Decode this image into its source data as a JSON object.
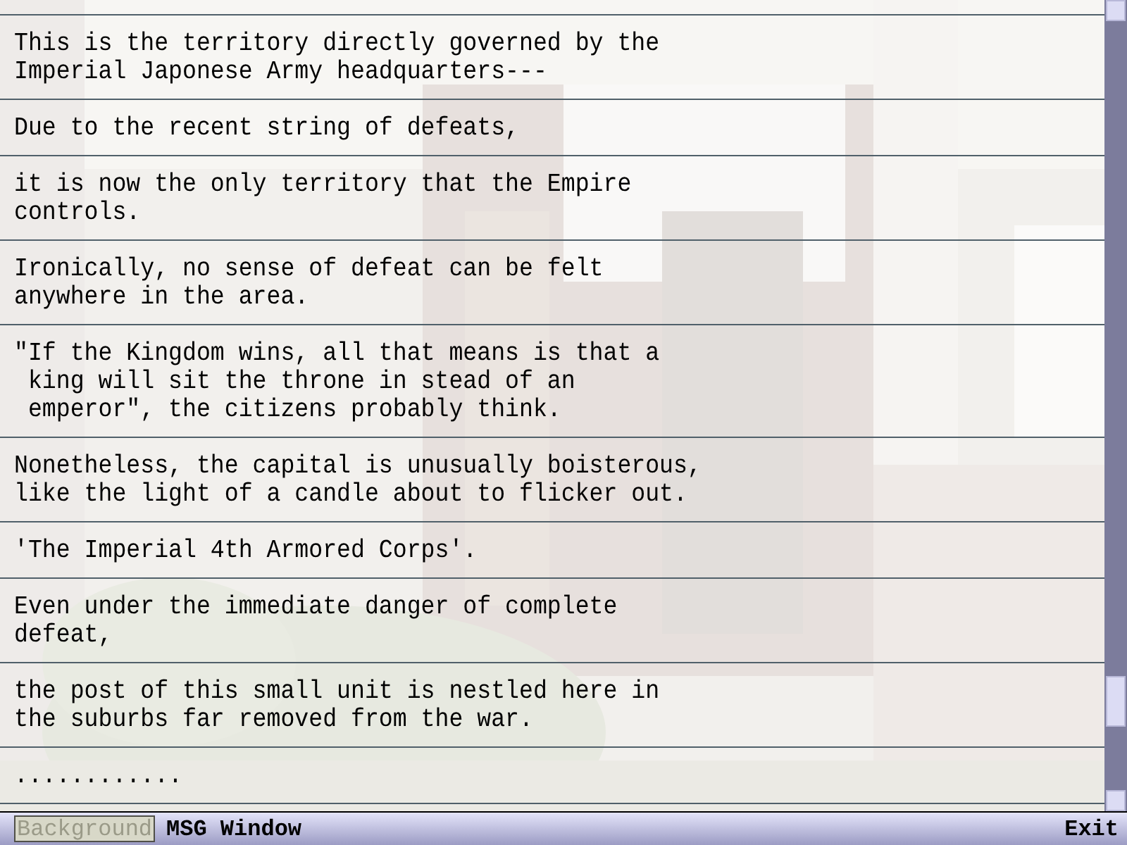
{
  "log": [
    {
      "lines": [
        "This is the territory directly governed by the",
        "Imperial Japonese Army headquarters---"
      ]
    },
    {
      "lines": [
        "Due to the recent string of defeats,"
      ]
    },
    {
      "lines": [
        "it is now the only territory that the Empire",
        "controls."
      ]
    },
    {
      "lines": [
        "Ironically, no sense of defeat can be felt",
        "anywhere in the area."
      ]
    },
    {
      "lines": [
        "\"If the Kingdom wins, all that means is that a",
        " king will sit the throne in stead of an",
        " emperor\", the citizens probably think."
      ]
    },
    {
      "lines": [
        "Nonetheless, the capital is unusually boisterous,",
        "like the light of a candle about to flicker out."
      ]
    },
    {
      "lines": [
        "'The Imperial 4th Armored Corps'."
      ]
    },
    {
      "lines": [
        "Even under the immediate danger of complete",
        "defeat,"
      ]
    },
    {
      "lines": [
        "the post of this small unit is nestled here in",
        "the suburbs far removed from the war."
      ]
    },
    {
      "lines": [
        "............"
      ]
    }
  ],
  "bottom_bar": {
    "buttons": [
      {
        "label": "Background",
        "selected": true
      },
      {
        "label": "MSG Window",
        "selected": false
      }
    ],
    "exit": "Exit"
  }
}
